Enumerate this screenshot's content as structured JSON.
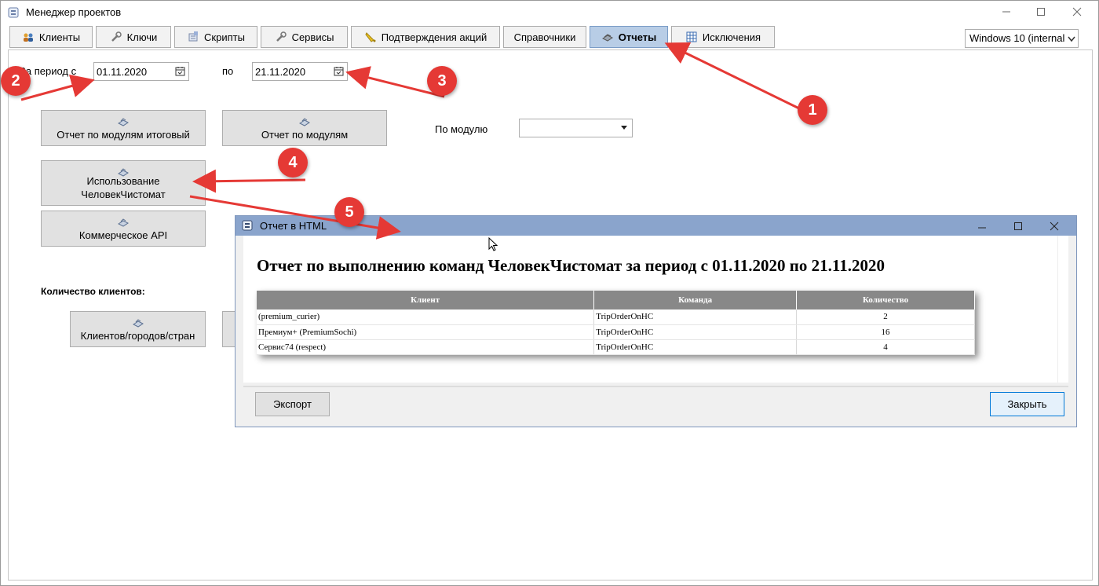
{
  "window": {
    "title": "Менеджер проектов"
  },
  "tabs": [
    {
      "label": "Клиенты",
      "icon": "users-icon"
    },
    {
      "label": "Ключи",
      "icon": "wrench-icon"
    },
    {
      "label": "Скрипты",
      "icon": "scripts-icon"
    },
    {
      "label": "Сервисы",
      "icon": "wrench-icon"
    },
    {
      "label": "Подтверждения акций",
      "icon": "bell-icon"
    },
    {
      "label": "Справочники",
      "icon": ""
    },
    {
      "label": "Отчеты",
      "icon": "reports-icon",
      "active": true
    },
    {
      "label": "Исключения",
      "icon": "table-icon"
    }
  ],
  "environment_combo": {
    "value": "Windows 10 (internal"
  },
  "filters": {
    "period_from_label": "За период с",
    "date_from": "01.11.2020",
    "period_to_label": "по",
    "date_to": "21.11.2020",
    "module_label": "По модулю",
    "module_value": ""
  },
  "buttons": {
    "modules_total": "Отчет по модулям итоговый",
    "modules": "Отчет по модулям",
    "usage_line1": "Использование",
    "usage_line2": "ЧеловекЧистомат",
    "commercial_api": "Коммерческое API",
    "clients_count_label": "Количество клиентов:",
    "clients_cities": "Клиентов/городов/стран"
  },
  "dialog": {
    "title": "Отчет в HTML",
    "report_title": "Отчет по выполнению команд ЧеловекЧистомат за период с 01.11.2020 по 21.11.2020",
    "table": {
      "headers": [
        "Клиент",
        "Команда",
        "Количество"
      ],
      "rows": [
        [
          "(premium_curier)",
          "TripOrderOnHC",
          "2"
        ],
        [
          "Премиум+ (PremiumSochi)",
          "TripOrderOnHC",
          "16"
        ],
        [
          "Сервис74 (respect)",
          "TripOrderOnHC",
          "4"
        ]
      ]
    },
    "export_label": "Экспорт",
    "close_label": "Закрыть"
  },
  "annotations": {
    "badges": [
      "1",
      "2",
      "3",
      "4",
      "5"
    ],
    "color": "#e53935"
  }
}
